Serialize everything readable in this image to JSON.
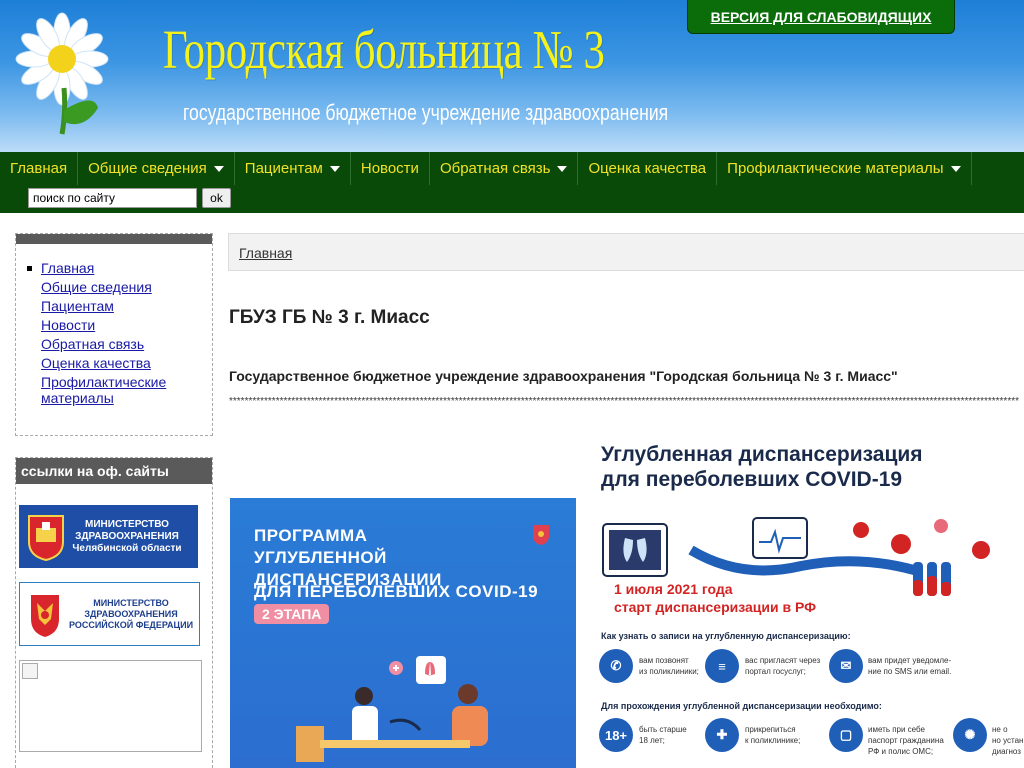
{
  "header": {
    "title": "Городская больница № 3",
    "subtitle": "государственное бюджетное учреждение здравоохранения",
    "vision_button": "ВЕРСИЯ ДЛЯ СЛАБОВИДЯЩИХ"
  },
  "nav": {
    "items": [
      {
        "label": "Главная",
        "dropdown": false
      },
      {
        "label": "Общие сведения",
        "dropdown": true
      },
      {
        "label": "Пациентам",
        "dropdown": true
      },
      {
        "label": "Новости",
        "dropdown": false
      },
      {
        "label": "Обратная связь",
        "dropdown": true
      },
      {
        "label": "Оценка качества",
        "dropdown": false
      },
      {
        "label": "Профилактические материалы",
        "dropdown": true
      }
    ],
    "search_value": "поиск по сайту",
    "search_button": "ok"
  },
  "sidebar": {
    "menu": [
      "Главная",
      "Общие сведения",
      "Пациентам",
      "Новости",
      "Обратная связь",
      "Оценка качества",
      "Профилактические материалы"
    ],
    "links_title": "ссылки на оф. сайты",
    "banner1": "МИНИСТЕРСТВО ЗДРАВООХРАНЕНИЯ Челябинской области",
    "banner2": "МИНИСТЕРСТВО ЗДРАВООХРАНЕНИЯ РОССИЙСКОЙ ФЕДЕРАЦИИ"
  },
  "main": {
    "breadcrumb": "Главная",
    "title": "ГБУЗ ГБ № 3 г. Миасс",
    "intro": "Государственное бюджетное учреждение здравоохранения \"Городская больница № 3 г. Миасс\"",
    "stars": "*****************************************************************************************************************************************************************************************************************************************"
  },
  "poster1": {
    "lines": [
      "ПРОГРАММА",
      "УГЛУБЛЕННОЙ",
      "ДИСПАНСЕРИЗАЦИИ",
      "ДЛЯ ПЕРЕБОЛЕВШИХ COVID-19"
    ],
    "badge": "2 ЭТАПА"
  },
  "poster2": {
    "title_line1": "Углубленная диспансеризация",
    "title_line2": "для переболевших COVID-19",
    "date_line1": "1 июля 2021 года",
    "date_line2": "старт диспансеризации в РФ",
    "question1": "Как узнать о записи на углубленную диспансеризацию:",
    "answer1": "вам позвонят",
    "answer1b": "из поликлиники;",
    "answer2": "вас пригласят через",
    "answer2b": "портал госуслуг;",
    "answer3": "вам придет уведомле-",
    "answer3b": "ние по SMS или email.",
    "question2": "Для прохождения углубленной диспансеризации необходимо:",
    "age_badge": "18+",
    "req1": "быть старше",
    "req1b": "18 лет;",
    "req2": "прикрепиться",
    "req2b": "к поликлинике;",
    "req3": "иметь при себе",
    "req3b": "паспорт гражданина",
    "req3c": "РФ и полис ОМС;",
    "req4": "не о",
    "req4b": "но устан",
    "req4c": "диагноз"
  },
  "colors": {
    "header_blue": "#1e7fd8",
    "nav_green": "#094a09",
    "nav_text_yellow": "#f2e227",
    "title_yellow": "#f4f21a"
  }
}
